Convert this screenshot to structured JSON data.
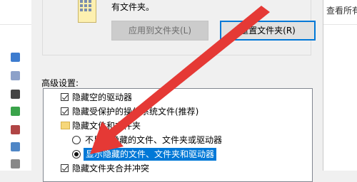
{
  "background_right": {
    "text": "查看所有"
  },
  "dialog": {
    "info_text": "有文件夹。",
    "apply_button": "应用到文件夹(L)",
    "reset_button": "重置文件夹(R)",
    "advanced_label": "高级设置:",
    "items": [
      {
        "type": "checkbox",
        "checked": true,
        "label": "隐藏空的驱动器"
      },
      {
        "type": "checkbox",
        "checked": true,
        "label": "隐藏受保护的操作系统文件(推荐)"
      },
      {
        "type": "folder",
        "label": "隐藏文件和文件夹"
      },
      {
        "type": "radio",
        "checked": false,
        "label": "不显示隐藏的文件、文件夹或驱动器"
      },
      {
        "type": "radio",
        "checked": true,
        "label": "显示隐藏的文件、文件夹和驱动器"
      },
      {
        "type": "checkbox",
        "checked": true,
        "label": "隐藏文件夹合并冲突"
      }
    ]
  },
  "colors": {
    "selection": "#0078d7",
    "arrow": "#e53935",
    "focus_border": "#0078d7"
  },
  "icons": [
    "folder-icon",
    "red-arrow-annotation"
  ]
}
